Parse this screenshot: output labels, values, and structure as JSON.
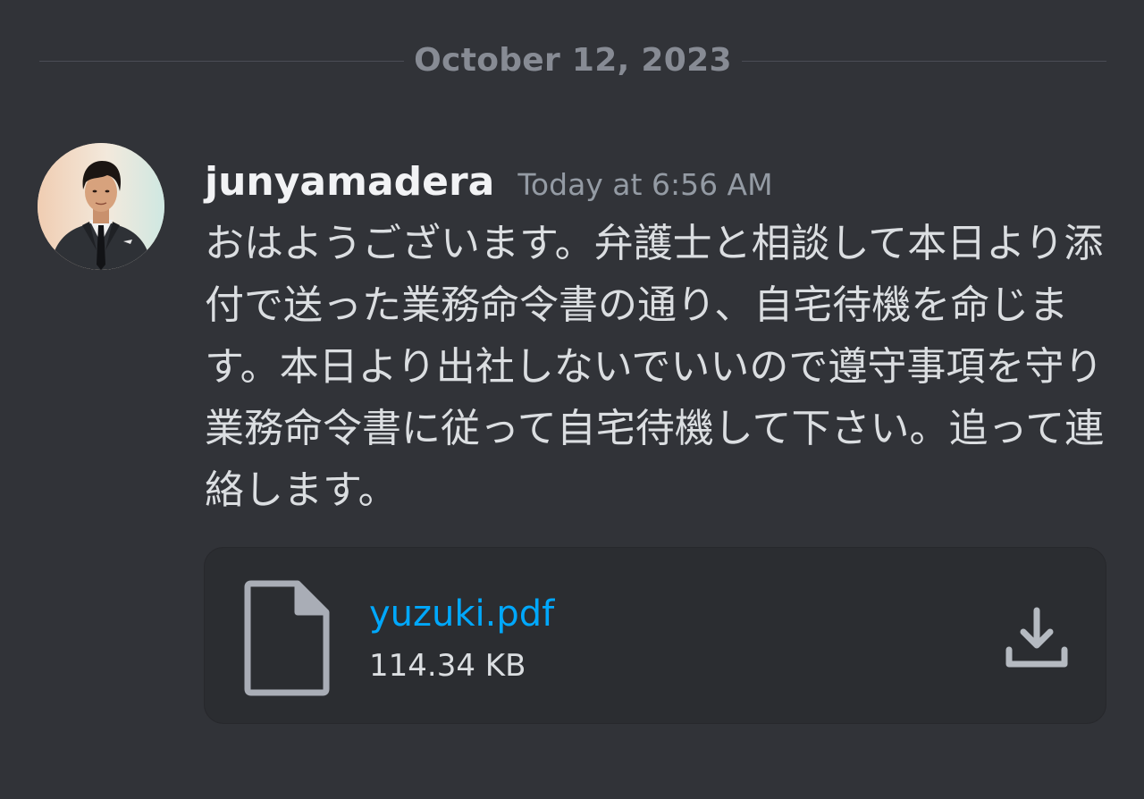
{
  "divider": {
    "date": "October 12, 2023"
  },
  "message": {
    "username": "junyamadera",
    "timestamp": "Today at 6:56 AM",
    "text": "おはようございます。弁護士と相談して本日より添付で送った業務命令書の通り、自宅待機を命じます。本日より出社しないでいいので遵守事項を守り業務命令書に従って自宅待機して下さい。追って連絡します。"
  },
  "attachment": {
    "file_name": "yuzuki.pdf",
    "file_size": "114.34 KB",
    "icon": "file-icon",
    "action_icon": "download-icon"
  },
  "colors": {
    "background": "#313338",
    "link": "#00a8fc",
    "username": "#f2f3f5",
    "text": "#dbdee1",
    "muted": "#949ba4"
  }
}
